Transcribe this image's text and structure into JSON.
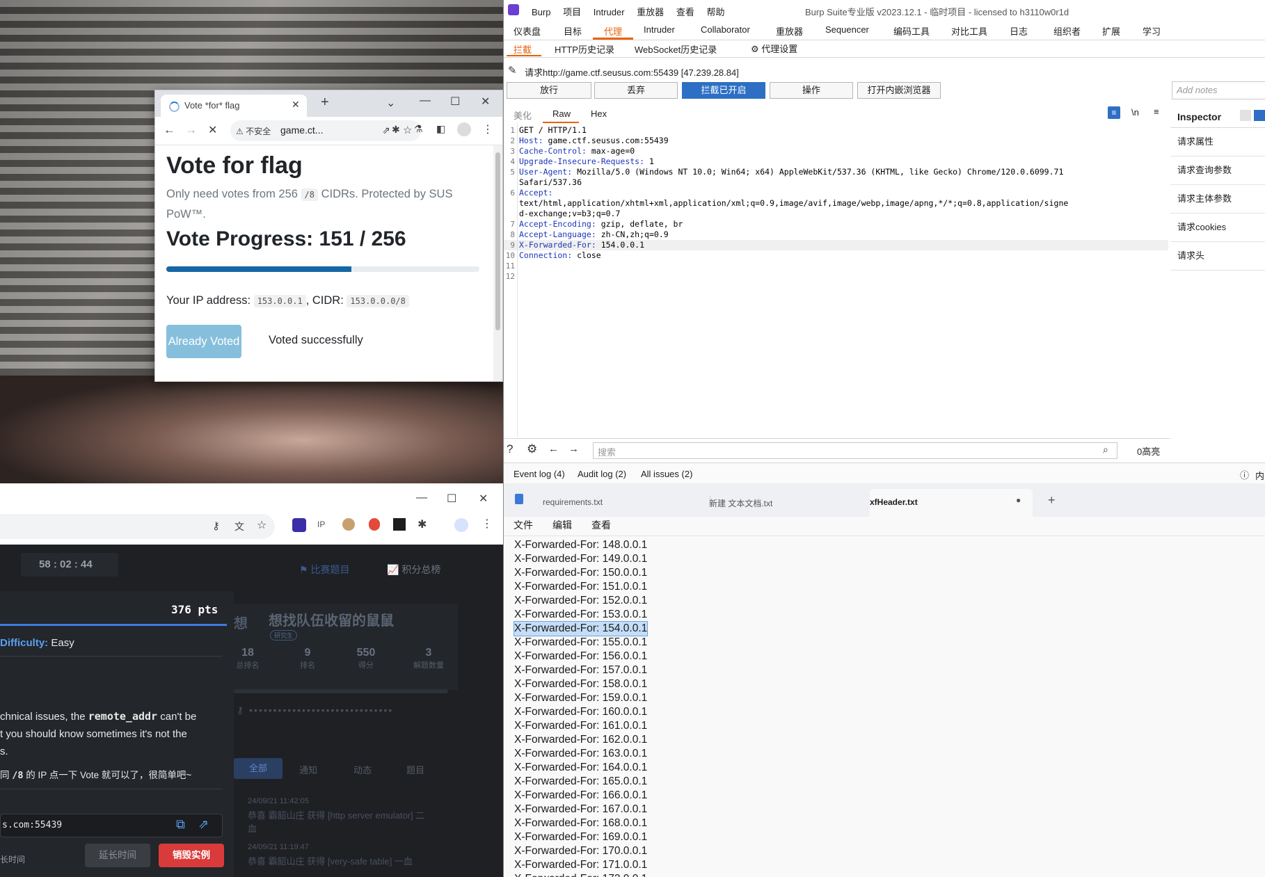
{
  "vote_window": {
    "tab_title": "Vote *for* flag",
    "insecure_label": "不安全",
    "url": "game.ct...",
    "heading": "Vote for flag",
    "subtitle_pre": "Only need votes from 256",
    "subtitle_code": "/8",
    "subtitle_post": "CIDRs. Protected by SUS",
    "subtitle_tail": "PoW™.",
    "progress_title": "Vote Progress: 151 / 256",
    "progress_fraction": 0.59,
    "ip_label": "Your IP address:",
    "ip_value": "153.0.0.1",
    "cidr_label": ", CIDR:",
    "cidr_value": "153.0.0.0/8",
    "button_label": "Already Voted",
    "status_text": "Voted successfully"
  },
  "ctf": {
    "timer": "58 : 02 : 44",
    "nav_challenges": "比赛题目",
    "nav_scoreboard": "积分总榜",
    "points": "376 pts",
    "difficulty_label": "Difficulty:",
    "difficulty_value": "Easy",
    "desc_pre": "chnical issues, the",
    "desc_code": "remote_addr",
    "desc_post": "can't be",
    "desc_line2": "t you should know sometimes it's not the",
    "desc_line3": "s.",
    "desc_cn_pre": "同",
    "desc_cn_code": "/8",
    "desc_cn_post": "的 IP 点一下 Vote 就可以了，很简单吧~",
    "instance_host": "s.com:55439",
    "extend_label": "长时间",
    "extend_button": "延长时间",
    "destroy_button": "销毁实例",
    "team_badge": "想",
    "team_name": "想找队伍收留的鼠鼠",
    "team_tag": "研究生",
    "stats": [
      {
        "value": "18",
        "label": "总排名"
      },
      {
        "value": "9",
        "label": "排名"
      },
      {
        "value": "550",
        "label": "得分"
      },
      {
        "value": "3",
        "label": "解题数量"
      }
    ],
    "feed_tabs": [
      "全部",
      "通知",
      "动态",
      "题目"
    ],
    "feed": [
      {
        "time": "24/09/21 11:42:05",
        "text": "恭喜 霸韶山庄 获得 [http server emulator] 二"
      },
      {
        "time": "",
        "text": "血"
      },
      {
        "time": "24/09/21 11:19:47",
        "text": "恭喜 霸韶山庄 获得 [very-safe table] 一血"
      }
    ]
  },
  "burp": {
    "menus": [
      "Burp",
      "项目",
      "Intruder",
      "重放器",
      "查看",
      "帮助"
    ],
    "title": "Burp Suite专业版  v2023.12.1 - 临时项目 - licensed to h3110w0r1d",
    "tabs": [
      "仪表盘",
      "目标",
      "代理",
      "Intruder",
      "Collaborator",
      "重放器",
      "Sequencer",
      "编码工具",
      "对比工具",
      "日志",
      "组织者",
      "扩展",
      "学习"
    ],
    "active_tab": "代理",
    "subtabs": [
      "拦截",
      "HTTP历史记录",
      "WebSocket历史记录"
    ],
    "proxy_settings": "代理设置",
    "request_label": "请求http://game.ctf.seusus.com:55439  [47.239.28.84]",
    "buttons": [
      "放行",
      "丢弃",
      "拦截已开启",
      "操作",
      "打开内嵌浏览器"
    ],
    "notes_placeholder": "Add notes",
    "view_tabs": [
      "美化",
      "Raw",
      "Hex"
    ],
    "newline_label": "\\n",
    "request_lines": [
      {
        "n": "1",
        "key": "",
        "val": "GET / HTTP/1.1"
      },
      {
        "n": "2",
        "key": "Host:",
        "val": " game.ctf.seusus.com:55439"
      },
      {
        "n": "3",
        "key": "Cache-Control:",
        "val": " max-age=0"
      },
      {
        "n": "4",
        "key": "Upgrade-Insecure-Requests:",
        "val": " 1"
      },
      {
        "n": "5",
        "key": "User-Agent:",
        "val": " Mozilla/5.0 (Windows NT 10.0; Win64; x64) AppleWebKit/537.36 (KHTML, like Gecko) Chrome/120.0.6099.71"
      },
      {
        "n": "",
        "key": "",
        "val": "Safari/537.36"
      },
      {
        "n": "6",
        "key": "Accept:",
        "val": ""
      },
      {
        "n": "",
        "key": "",
        "val": "text/html,application/xhtml+xml,application/xml;q=0.9,image/avif,image/webp,image/apng,*/*;q=0.8,application/signe"
      },
      {
        "n": "",
        "key": "",
        "val": "d-exchange;v=b3;q=0.7"
      },
      {
        "n": "7",
        "key": "Accept-Encoding:",
        "val": " gzip, deflate, br"
      },
      {
        "n": "8",
        "key": "Accept-Language:",
        "val": " zh-CN,zh;q=0.9"
      },
      {
        "n": "9",
        "key": "X-Forwarded-For:",
        "val": " 154.0.0.1"
      },
      {
        "n": "10",
        "key": "Connection:",
        "val": " close"
      },
      {
        "n": "11",
        "key": "",
        "val": ""
      },
      {
        "n": "12",
        "key": "",
        "val": ""
      }
    ],
    "inspector_title": "Inspector",
    "inspector_items": [
      "请求属性",
      "请求查询参数",
      "请求主体参数",
      "请求cookies",
      "请求头"
    ],
    "search_placeholder": "搜索",
    "highlight_count": "0高亮",
    "bottom_tabs": [
      "Event log (4)",
      "Audit log (2)",
      "All issues (2)"
    ],
    "bottom_right": "内"
  },
  "notepad": {
    "tabs": [
      "requirements.txt",
      "新建 文本文档.txt",
      "xfHeader.txt"
    ],
    "menu": [
      "文件",
      "编辑",
      "查看"
    ],
    "highlight_index": 6,
    "lines": [
      "X-Forwarded-For: 148.0.0.1",
      "X-Forwarded-For: 149.0.0.1",
      "X-Forwarded-For: 150.0.0.1",
      "X-Forwarded-For: 151.0.0.1",
      "X-Forwarded-For: 152.0.0.1",
      "X-Forwarded-For: 153.0.0.1",
      "X-Forwarded-For: 154.0.0.1",
      "X-Forwarded-For: 155.0.0.1",
      "X-Forwarded-For: 156.0.0.1",
      "X-Forwarded-For: 157.0.0.1",
      "X-Forwarded-For: 158.0.0.1",
      "X-Forwarded-For: 159.0.0.1",
      "X-Forwarded-For: 160.0.0.1",
      "X-Forwarded-For: 161.0.0.1",
      "X-Forwarded-For: 162.0.0.1",
      "X-Forwarded-For: 163.0.0.1",
      "X-Forwarded-For: 164.0.0.1",
      "X-Forwarded-For: 165.0.0.1",
      "X-Forwarded-For: 166.0.0.1",
      "X-Forwarded-For: 167.0.0.1",
      "X-Forwarded-For: 168.0.0.1",
      "X-Forwarded-For: 169.0.0.1",
      "X-Forwarded-For: 170.0.0.1",
      "X-Forwarded-For: 171.0.0.1",
      "X-Forwarded-For: 172.0.0.1"
    ]
  },
  "colors": {
    "burp_orange": "#e8630a",
    "burp_blue": "#2d6fc4",
    "vote_button": "#86bfdc",
    "progress_fill": "#1667a6",
    "ctf_red": "#d93a3a",
    "selection": "#c5ddf6"
  }
}
